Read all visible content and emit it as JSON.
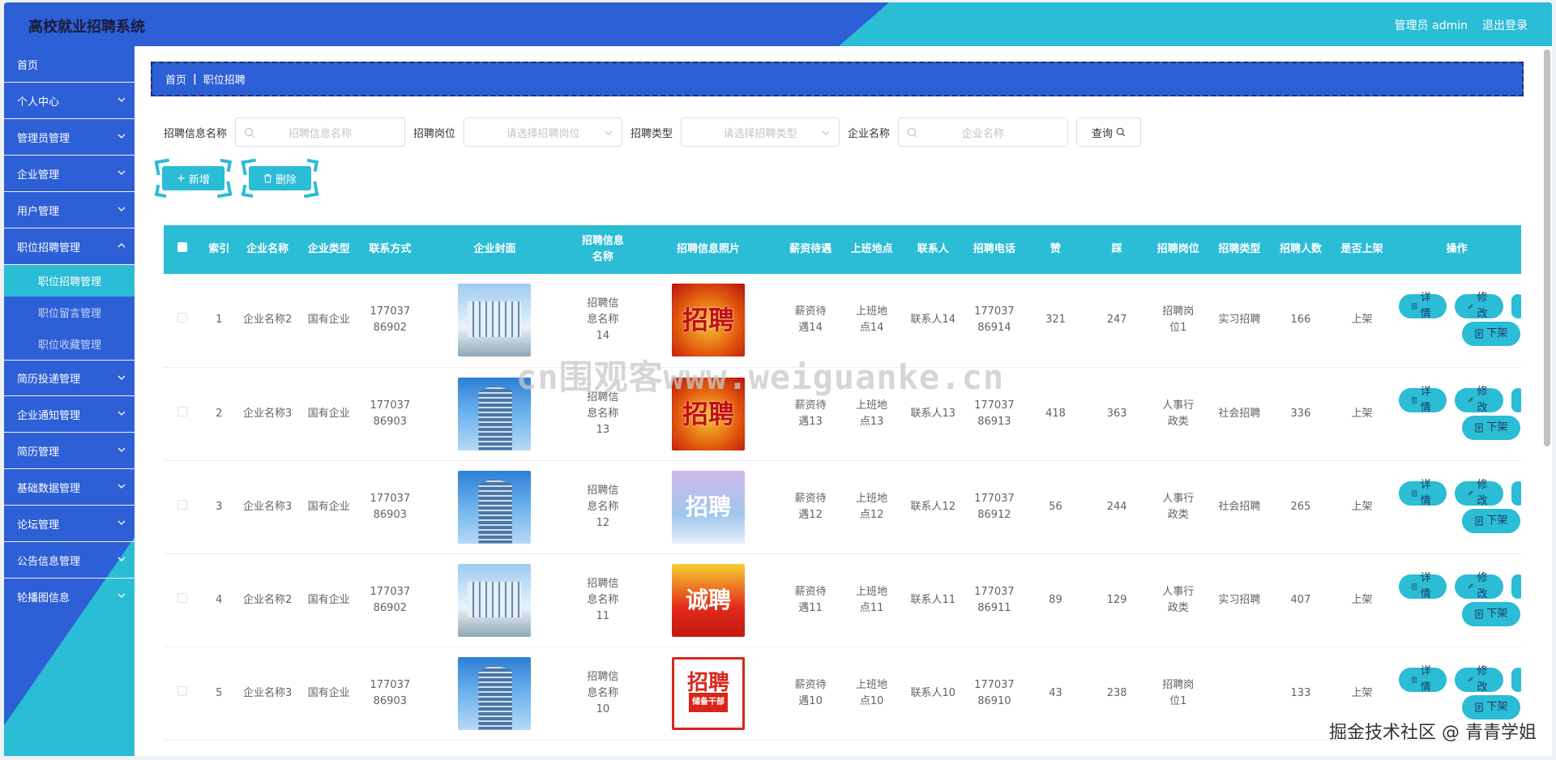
{
  "header": {
    "title": "高校就业招聘系统",
    "user": "管理员 admin",
    "logout": "退出登录"
  },
  "sidebar": {
    "items": [
      {
        "label": "首页"
      },
      {
        "label": "个人中心"
      },
      {
        "label": "管理员管理"
      },
      {
        "label": "企业管理"
      },
      {
        "label": "用户管理"
      },
      {
        "label": "职位招聘管理"
      },
      {
        "label": "简历投递管理"
      },
      {
        "label": "企业通知管理"
      },
      {
        "label": "简历管理"
      },
      {
        "label": "基础数据管理"
      },
      {
        "label": "论坛管理"
      },
      {
        "label": "公告信息管理"
      },
      {
        "label": "轮播图信息"
      }
    ],
    "submenu": [
      {
        "label": "职位招聘管理"
      },
      {
        "label": "职位留言管理"
      },
      {
        "label": "职位收藏管理"
      }
    ]
  },
  "breadcrumb": {
    "home": "首页",
    "sep": "|",
    "current": "职位招聘"
  },
  "search": {
    "f1_label": "招聘信息名称",
    "f1_placeholder": "招聘信息名称",
    "f2_label": "招聘岗位",
    "f2_placeholder": "请选择招聘岗位",
    "f3_label": "招聘类型",
    "f3_placeholder": "请选择招聘类型",
    "f4_label": "企业名称",
    "f4_placeholder": "企业名称",
    "query": "查询"
  },
  "actions": {
    "add": "新增",
    "delete": "删除"
  },
  "table": {
    "headers": [
      "索引",
      "企业名称",
      "企业类型",
      "联系方式",
      "企业封面",
      "招聘信息名称",
      "招聘信息照片",
      "薪资待遇",
      "上班地点",
      "联系人",
      "招聘电话",
      "赞",
      "踩",
      "招聘岗位",
      "招聘类型",
      "招聘人数",
      "是否上架",
      "操作"
    ],
    "rows": [
      {
        "idx": "1",
        "company": "企业名称2",
        "type": "国有企业",
        "phone": "17703786902",
        "name": "招聘信息名称14",
        "salary": "薪资待遇14",
        "place": "上班地点14",
        "contact": "联系人14",
        "tel": "17703786914",
        "up": "321",
        "down": "247",
        "post": "招聘岗位1",
        "rtype": "实习招聘",
        "num": "166",
        "status": "上架"
      },
      {
        "idx": "2",
        "company": "企业名称3",
        "type": "国有企业",
        "phone": "17703786903",
        "name": "招聘信息名称13",
        "salary": "薪资待遇13",
        "place": "上班地点13",
        "contact": "联系人13",
        "tel": "17703786913",
        "up": "418",
        "down": "363",
        "post": "人事行政类",
        "rtype": "社会招聘",
        "num": "336",
        "status": "上架"
      },
      {
        "idx": "3",
        "company": "企业名称3",
        "type": "国有企业",
        "phone": "17703786903",
        "name": "招聘信息名称12",
        "salary": "薪资待遇12",
        "place": "上班地点12",
        "contact": "联系人12",
        "tel": "17703786912",
        "up": "56",
        "down": "244",
        "post": "人事行政类",
        "rtype": "社会招聘",
        "num": "265",
        "status": "上架"
      },
      {
        "idx": "4",
        "company": "企业名称2",
        "type": "国有企业",
        "phone": "17703786902",
        "name": "招聘信息名称11",
        "salary": "薪资待遇11",
        "place": "上班地点11",
        "contact": "联系人11",
        "tel": "17703786911",
        "up": "89",
        "down": "129",
        "post": "人事行政类",
        "rtype": "实习招聘",
        "num": "407",
        "status": "上架"
      },
      {
        "idx": "5",
        "company": "企业名称3",
        "type": "国有企业",
        "phone": "17703786903",
        "name": "招聘信息名称10",
        "salary": "薪资待遇10",
        "place": "上班地点10",
        "contact": "联系人10",
        "tel": "17703786910",
        "up": "43",
        "down": "238",
        "post": "招聘岗位1",
        "rtype": "",
        "num": "133",
        "status": "上架"
      }
    ],
    "ops": {
      "detail": "详情",
      "edit": "修改",
      "off": "下架"
    },
    "poster_text": [
      "招聘",
      "招聘",
      "招聘",
      "诚聘",
      "招聘"
    ],
    "poster_sub": "储备干部"
  },
  "overlay": {
    "watermark": "cn围观客www.weiguanke.cn",
    "juejin": "掘金技术社区 @ 青青学姐"
  },
  "colors": {
    "blue": "#2d5fd6",
    "cyan": "#2bbcd6"
  }
}
